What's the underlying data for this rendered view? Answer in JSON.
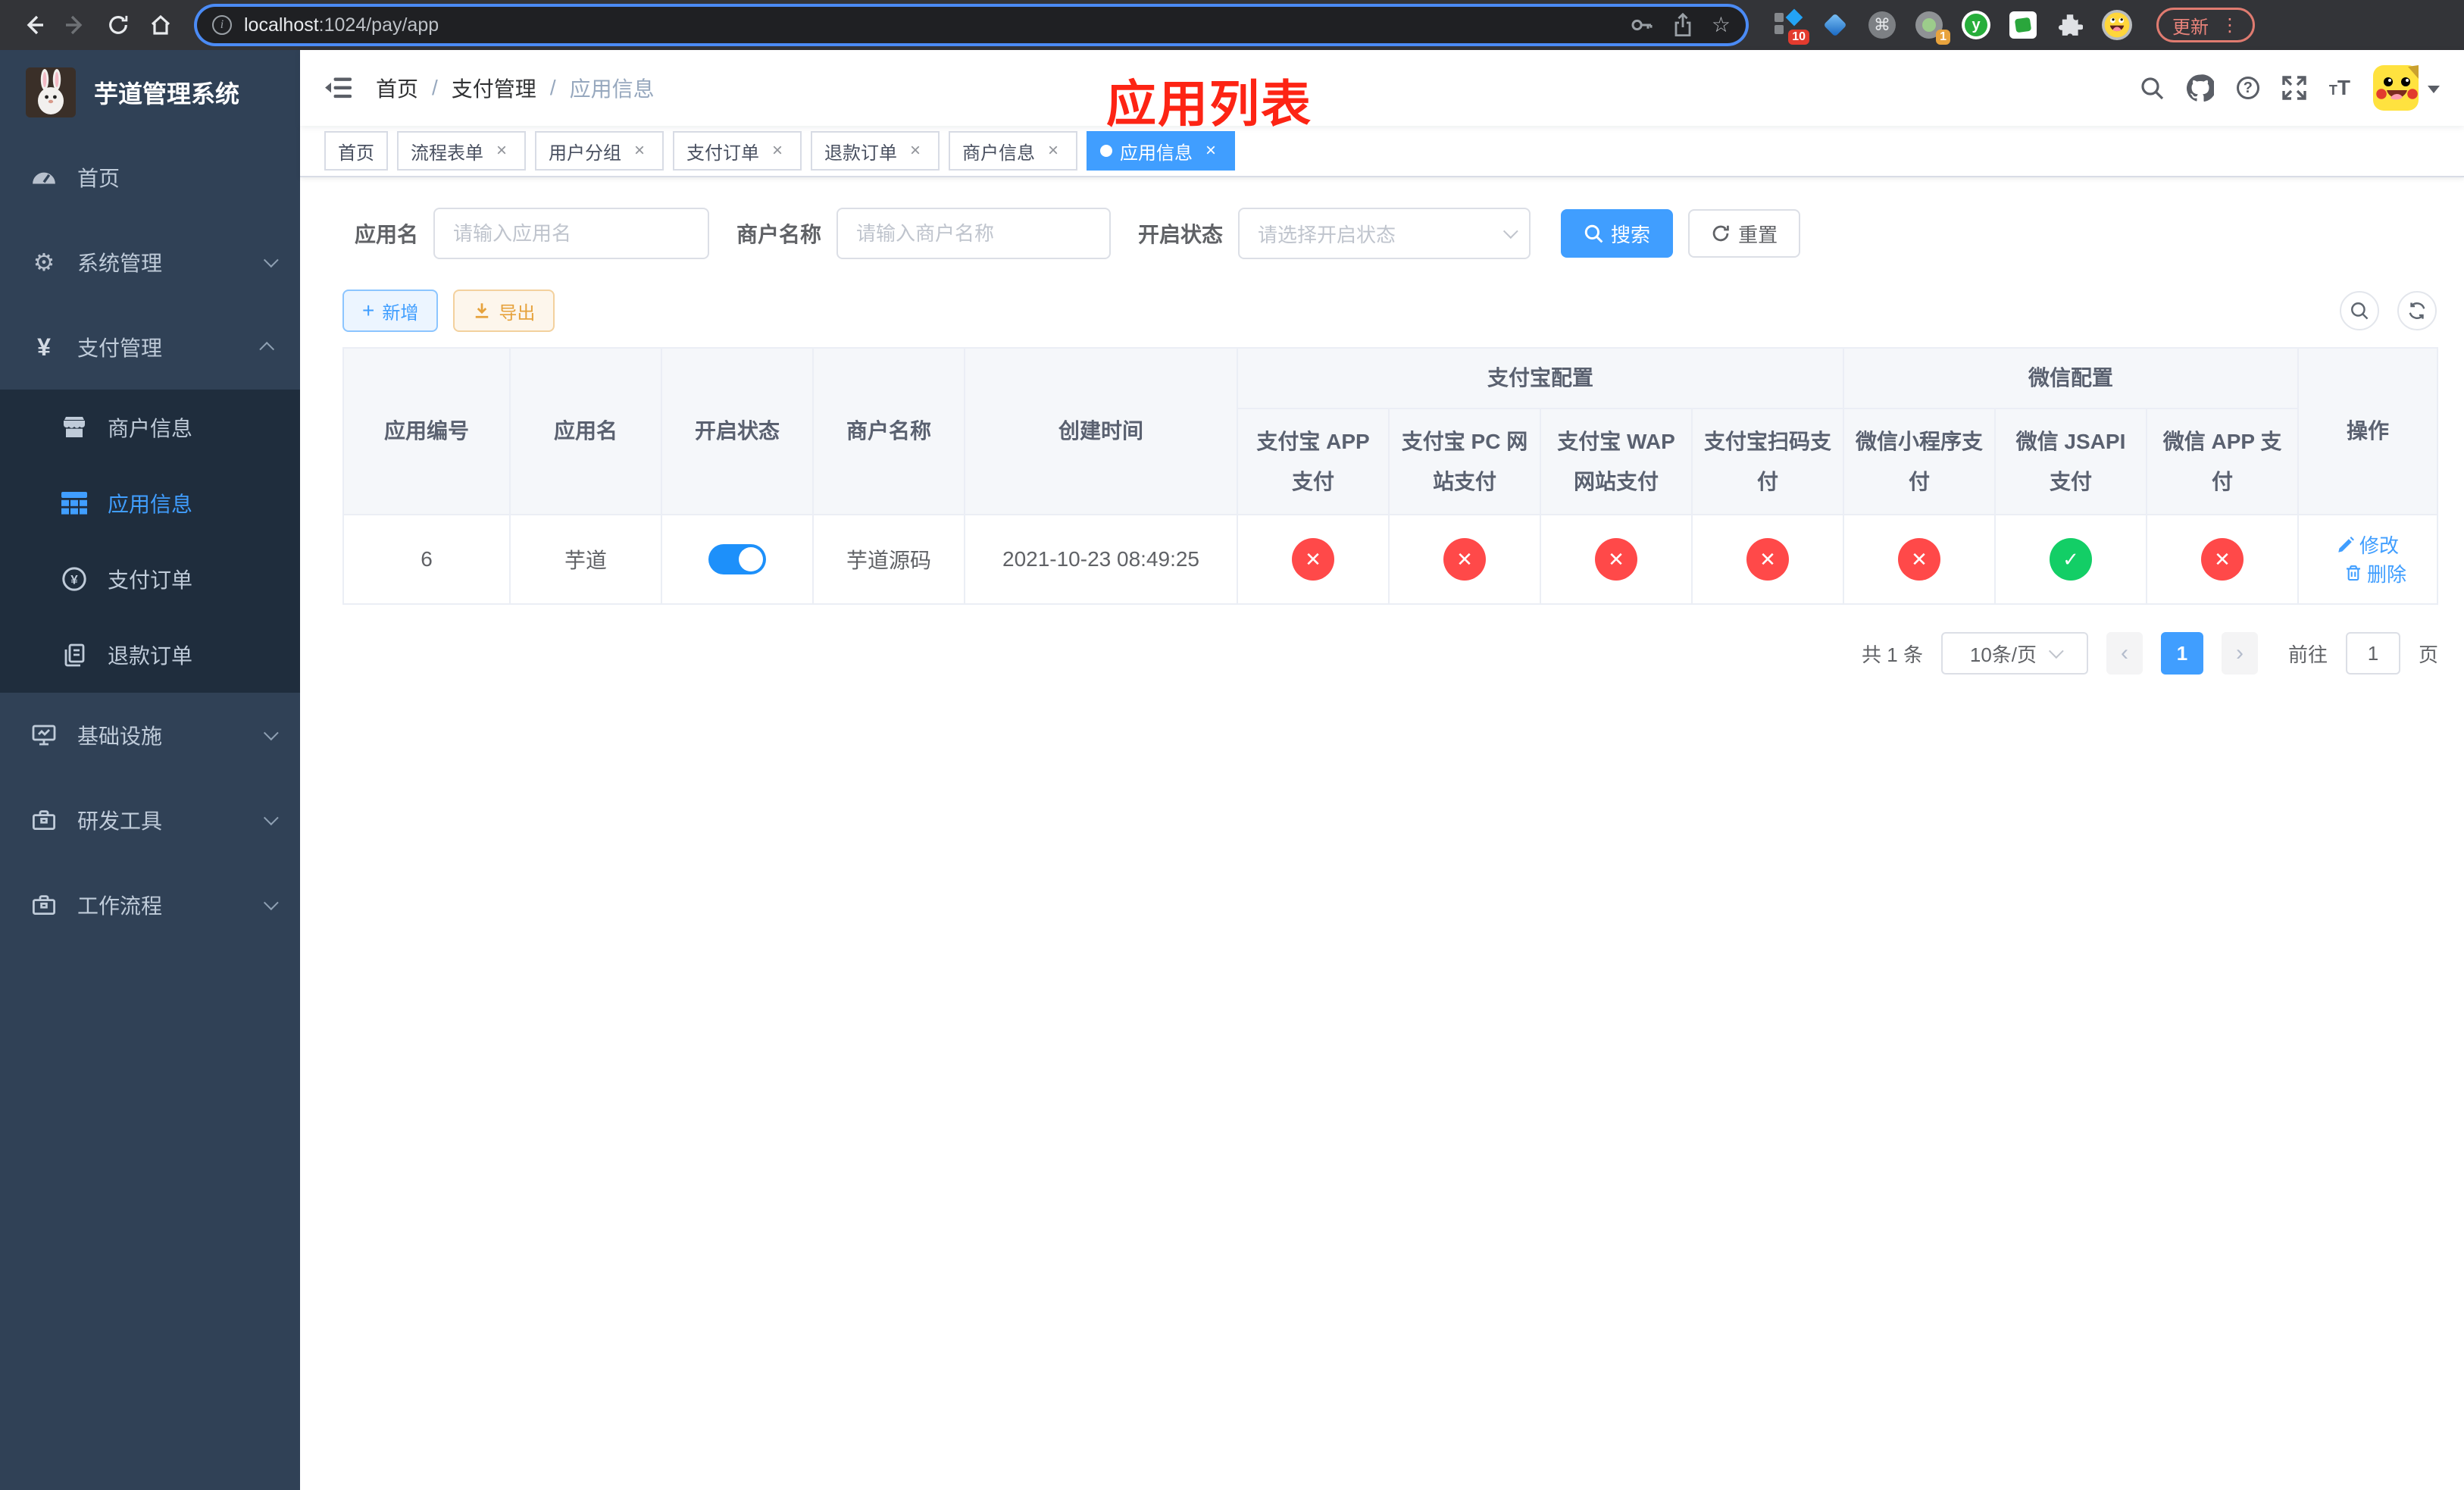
{
  "browser": {
    "url": {
      "host": "localhost",
      "path": ":1024/pay/app"
    },
    "update_label": "更新",
    "ext_badges": {
      "first": "10",
      "fourth": "1"
    }
  },
  "sidebar": {
    "title": "芋道管理系统",
    "menu": [
      {
        "label": "首页"
      },
      {
        "label": "系统管理"
      },
      {
        "label": "支付管理"
      },
      {
        "label": "基础设施"
      },
      {
        "label": "研发工具"
      },
      {
        "label": "工作流程"
      }
    ],
    "submenu": [
      {
        "label": "商户信息"
      },
      {
        "label": "应用信息"
      },
      {
        "label": "支付订单"
      },
      {
        "label": "退款订单"
      }
    ]
  },
  "header": {
    "breadcrumb": {
      "home": "首页",
      "section": "支付管理",
      "current": "应用信息"
    },
    "overlay_title": "应用列表"
  },
  "tabs": [
    {
      "label": "首页"
    },
    {
      "label": "流程表单"
    },
    {
      "label": "用户分组"
    },
    {
      "label": "支付订单"
    },
    {
      "label": "退款订单"
    },
    {
      "label": "商户信息"
    },
    {
      "label": "应用信息"
    }
  ],
  "filters": {
    "app_name": {
      "label": "应用名",
      "placeholder": "请输入应用名"
    },
    "merchant_name": {
      "label": "商户名称",
      "placeholder": "请输入商户名称"
    },
    "status": {
      "label": "开启状态",
      "placeholder": "请选择开启状态"
    },
    "search_label": "搜索",
    "reset_label": "重置"
  },
  "toolbar": {
    "add_label": "新增",
    "export_label": "导出"
  },
  "table": {
    "groups": {
      "alipay": "支付宝配置",
      "wechat": "微信配置"
    },
    "columns": {
      "app_id": "应用编号",
      "app_name": "应用名",
      "status": "开启状态",
      "merchant": "商户名称",
      "create_time": "创建时间",
      "alipay_app": "支付宝 APP 支付",
      "alipay_pc": "支付宝 PC 网站支付",
      "alipay_wap": "支付宝 WAP 网站支付",
      "alipay_qr": "支付宝扫码支付",
      "wx_lite": "微信小程序支付",
      "wx_jsapi": "微信 JSAPI 支付",
      "wx_app": "微信 APP 支付",
      "actions": "操作"
    },
    "row": {
      "app_id": "6",
      "app_name": "芋道",
      "status_on": true,
      "merchant": "芋道源码",
      "create_time": "2021-10-23 08:49:25",
      "channels": [
        false,
        false,
        false,
        false,
        false,
        true,
        false
      ],
      "edit_label": "修改",
      "delete_label": "删除"
    }
  },
  "pagination": {
    "total_label": "共 1 条",
    "page_size": "10条/页",
    "page": "1",
    "goto_label": "前往",
    "goto_value": "1",
    "unit_label": "页"
  },
  "icons": {
    "close": "×",
    "slash": "/",
    "prev": "‹",
    "next": "›",
    "command": "⌘",
    "star": "☆",
    "yen": "¥",
    "gear": "⚙",
    "question": "?",
    "check": "✓",
    "cross": "✕",
    "kebab": "⋮",
    "info_i": "i",
    "font_t": "T",
    "y_logo": "y",
    "plus": "+"
  },
  "colors": {
    "primary": "#409eff",
    "success": "#13ce66",
    "danger": "#ff4949",
    "warning": "#e6a23c",
    "sidebar_bg": "#304156",
    "submenu_bg": "#1f2d3d",
    "overlay_title": "#fd2414",
    "toggle_on": "#1d90fa"
  }
}
